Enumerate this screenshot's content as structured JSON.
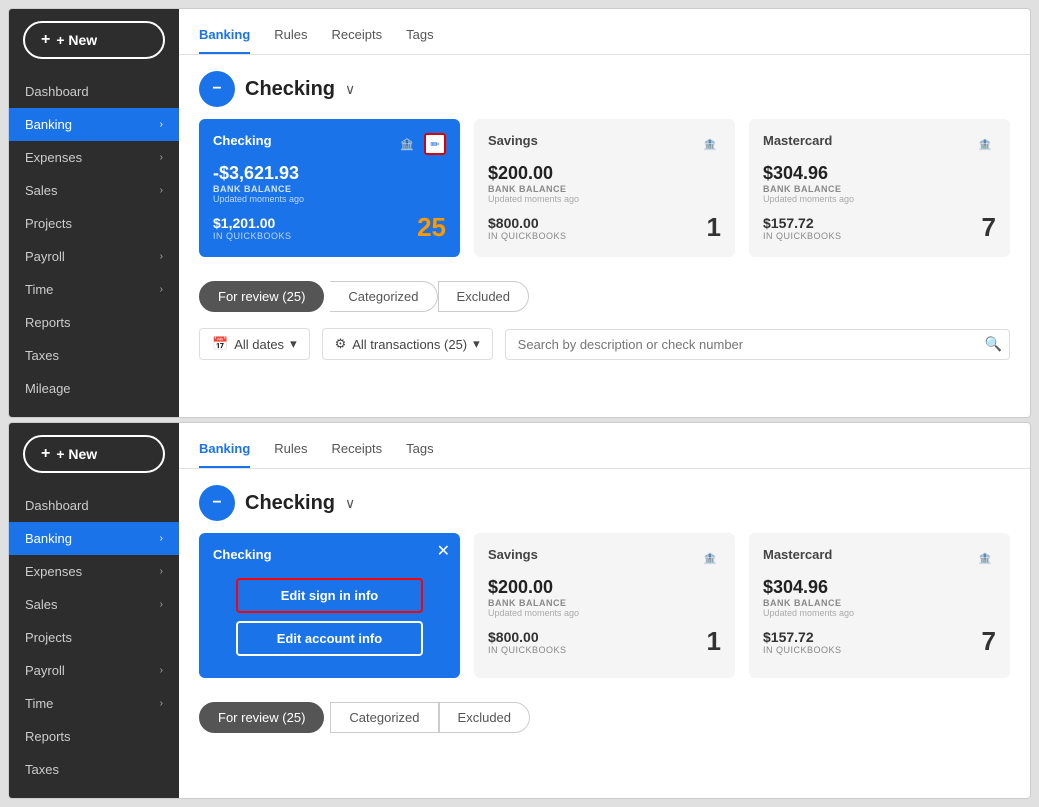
{
  "panel1": {
    "sidebar": {
      "new_label": "+ New",
      "items": [
        {
          "label": "Dashboard",
          "active": false,
          "has_chevron": false
        },
        {
          "label": "Banking",
          "active": true,
          "has_chevron": true
        },
        {
          "label": "Expenses",
          "active": false,
          "has_chevron": true
        },
        {
          "label": "Sales",
          "active": false,
          "has_chevron": true
        },
        {
          "label": "Projects",
          "active": false,
          "has_chevron": false
        },
        {
          "label": "Payroll",
          "active": false,
          "has_chevron": true
        },
        {
          "label": "Time",
          "active": false,
          "has_chevron": true
        },
        {
          "label": "Reports",
          "active": false,
          "has_chevron": false
        },
        {
          "label": "Taxes",
          "active": false,
          "has_chevron": false
        },
        {
          "label": "Mileage",
          "active": false,
          "has_chevron": false
        }
      ]
    },
    "tabs": [
      {
        "label": "Banking",
        "active": true
      },
      {
        "label": "Rules",
        "active": false
      },
      {
        "label": "Receipts",
        "active": false
      },
      {
        "label": "Tags",
        "active": false
      }
    ],
    "account": {
      "name": "Checking",
      "icon": "−"
    },
    "cards": [
      {
        "name": "Checking",
        "type": "blue",
        "balance": "-$3,621.93",
        "balance_label": "BANK BALANCE",
        "updated": "Updated moments ago",
        "in_qb": "$1,201.00",
        "in_qb_label": "IN QUICKBOOKS",
        "count": "25",
        "has_edit": true,
        "has_bank": true
      },
      {
        "name": "Savings",
        "type": "gray",
        "balance": "$200.00",
        "balance_label": "BANK BALANCE",
        "updated": "Updated moments ago",
        "in_qb": "$800.00",
        "in_qb_label": "IN QUICKBOOKS",
        "count": "1",
        "has_edit": false,
        "has_bank": true
      },
      {
        "name": "Mastercard",
        "type": "gray",
        "balance": "$304.96",
        "balance_label": "BANK BALANCE",
        "updated": "Updated moments ago",
        "in_qb": "$157.72",
        "in_qb_label": "IN QUICKBOOKS",
        "count": "7",
        "has_edit": false,
        "has_bank": true
      }
    ],
    "filter_tabs": [
      {
        "label": "For review (25)",
        "active": true
      },
      {
        "label": "Categorized",
        "active": false
      },
      {
        "label": "Excluded",
        "active": false
      }
    ],
    "search": {
      "date_label": "All dates",
      "transactions_label": "All transactions (25)",
      "placeholder": "Search by description or check number"
    }
  },
  "panel2": {
    "sidebar": {
      "new_label": "+ New",
      "items": [
        {
          "label": "Dashboard",
          "active": false,
          "has_chevron": false
        },
        {
          "label": "Banking",
          "active": true,
          "has_chevron": true
        },
        {
          "label": "Expenses",
          "active": false,
          "has_chevron": true
        },
        {
          "label": "Sales",
          "active": false,
          "has_chevron": true
        },
        {
          "label": "Projects",
          "active": false,
          "has_chevron": false
        },
        {
          "label": "Payroll",
          "active": false,
          "has_chevron": true
        },
        {
          "label": "Time",
          "active": false,
          "has_chevron": true
        },
        {
          "label": "Reports",
          "active": false,
          "has_chevron": false
        },
        {
          "label": "Taxes",
          "active": false,
          "has_chevron": false
        }
      ]
    },
    "tabs": [
      {
        "label": "Banking",
        "active": true
      },
      {
        "label": "Rules",
        "active": false
      },
      {
        "label": "Receipts",
        "active": false
      },
      {
        "label": "Tags",
        "active": false
      }
    ],
    "account": {
      "name": "Checking",
      "icon": "−"
    },
    "popup_card": {
      "name": "Checking",
      "edit_signin_label": "Edit sign in info",
      "edit_account_label": "Edit account info"
    },
    "cards_right": [
      {
        "name": "Savings",
        "type": "gray",
        "balance": "$200.00",
        "balance_label": "BANK BALANCE",
        "updated": "Updated moments ago",
        "in_qb": "$800.00",
        "in_qb_label": "IN QUICKBOOKS",
        "count": "1"
      },
      {
        "name": "Mastercard",
        "type": "gray",
        "balance": "$304.96",
        "balance_label": "BANK BALANCE",
        "updated": "Updated moments ago",
        "in_qb": "$157.72",
        "in_qb_label": "IN QUICKBOOKS",
        "count": "7"
      }
    ],
    "filter_tabs": [
      {
        "label": "For review (25)",
        "active": true
      },
      {
        "label": "Categorized",
        "active": false
      },
      {
        "label": "Excluded",
        "active": false
      }
    ]
  }
}
